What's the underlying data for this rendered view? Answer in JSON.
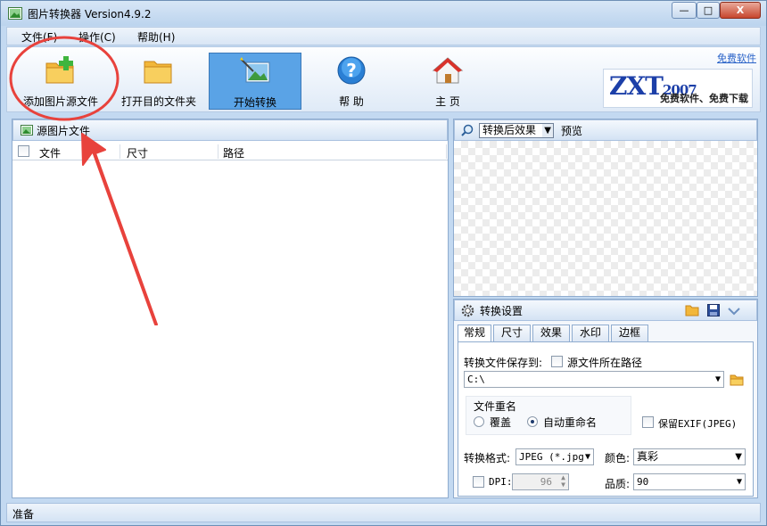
{
  "window": {
    "title": "图片转换器 Version4.9.2",
    "controls": {
      "minimize": "—",
      "maximize": "□",
      "close": "X"
    }
  },
  "menu": {
    "items": [
      {
        "label": "文件(F)"
      },
      {
        "label": "操作(C)"
      },
      {
        "label": "帮助(H)"
      }
    ]
  },
  "toolbar": {
    "buttons": [
      {
        "label": "添加图片源文件",
        "icon": "folder-add-icon"
      },
      {
        "label": "打开目的文件夹",
        "icon": "folder-icon"
      },
      {
        "label": "开始转换",
        "icon": "magic-wand-image-icon"
      },
      {
        "label": "帮 助",
        "icon": "help-icon"
      },
      {
        "label": "主 页",
        "icon": "home-icon"
      }
    ],
    "active_index": 2,
    "top_link": "免费软件",
    "logo": {
      "brand": "ZXT",
      "year": "2007",
      "slogan": "免费软件、免费下载"
    }
  },
  "source_panel": {
    "title": "源图片文件",
    "columns": [
      "文件",
      "尺寸",
      "路径"
    ],
    "rows": []
  },
  "preview_panel": {
    "select_value": "转换后效果",
    "label": "预览"
  },
  "settings_panel": {
    "title": "转换设置",
    "tabs": [
      "常规",
      "尺寸",
      "效果",
      "水印",
      "边框"
    ],
    "active_tab": 0,
    "save_to_label": "转换文件保存到:",
    "source_path_checkbox_label": "源文件所在路径",
    "save_path": "C:\\",
    "rename_group_label": "文件重名",
    "rename_options": [
      "覆盖",
      "自动重命名"
    ],
    "rename_selected": 1,
    "keep_exif_label": "保留EXIF(JPEG)",
    "format_label": "转换格式:",
    "format_value": "JPEG (*.jpg",
    "color_label": "颜色:",
    "color_value": "真彩",
    "dpi_label": "DPI:",
    "dpi_value": "96",
    "quality_label": "品质:",
    "quality_value": "90"
  },
  "status": {
    "text": "准备"
  },
  "colors": {
    "accent": "#5aa3e6",
    "annotation": "#e8423c"
  }
}
